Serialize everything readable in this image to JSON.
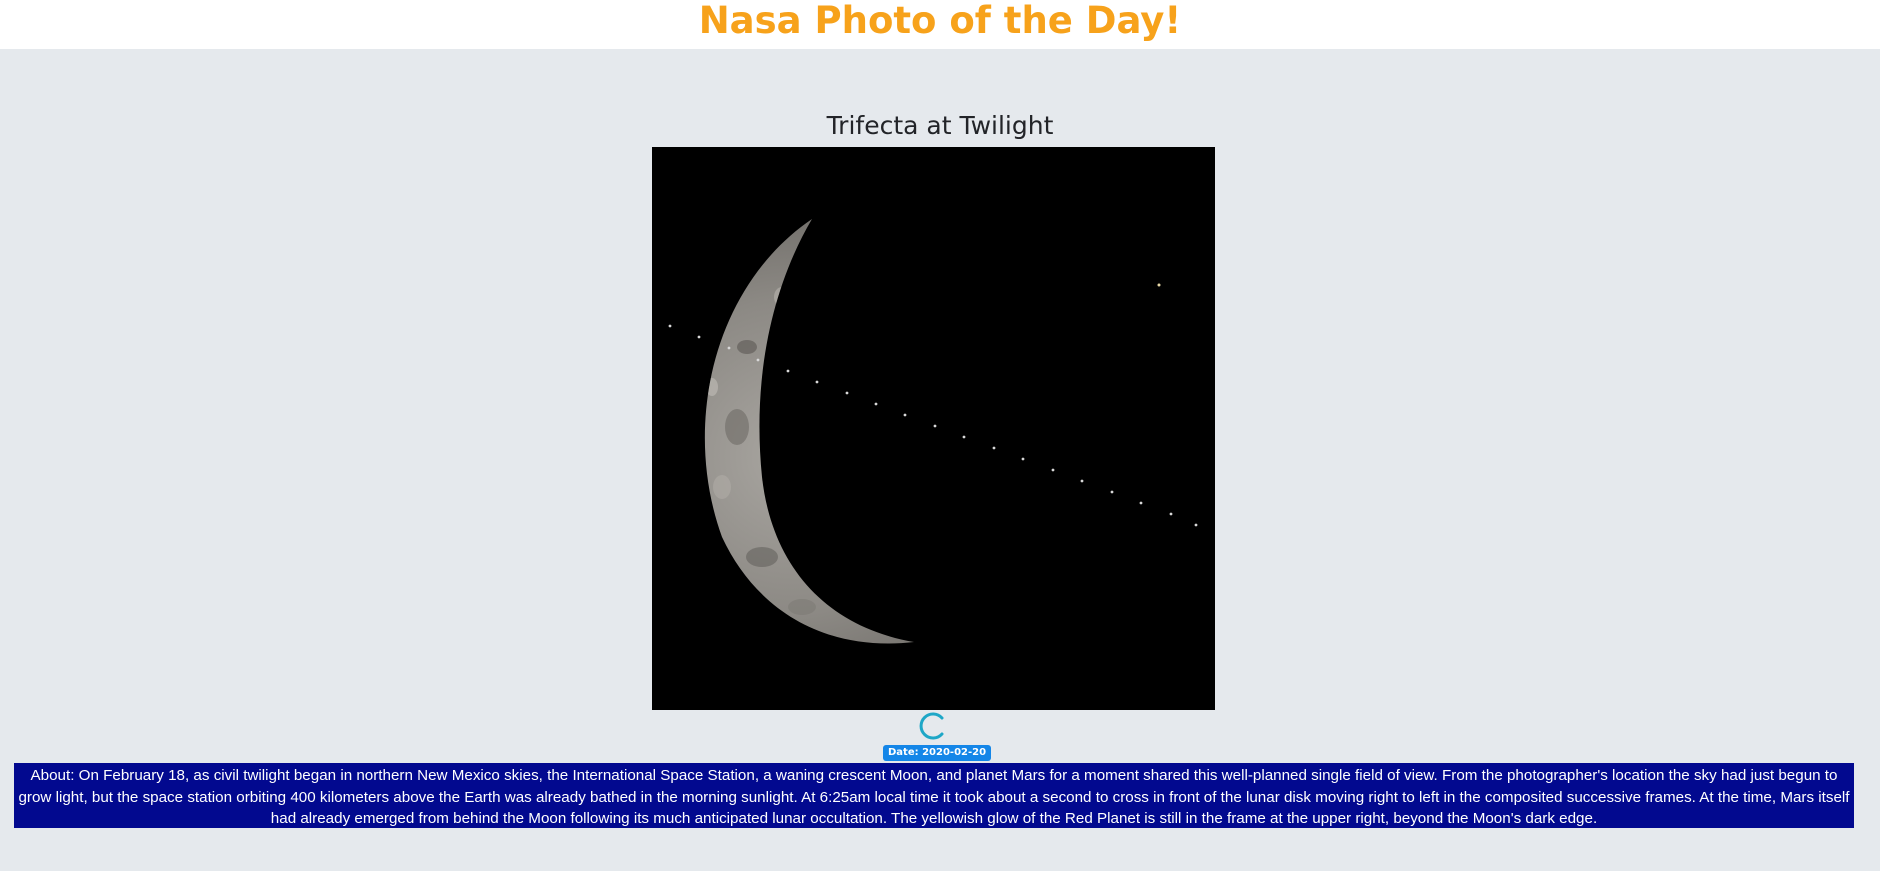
{
  "header": {
    "title": "Nasa Photo of the Day!"
  },
  "photo": {
    "title": "Trifecta at Twilight",
    "subject": "waning crescent Moon with International Space Station trail and Mars"
  },
  "loading": {
    "icon": "loading-spinner-icon",
    "color": "#1ea7c7"
  },
  "date_badge": {
    "label": "Date: 2020-02-20"
  },
  "about": {
    "text": "About: On February 18, as civil twilight began in northern New Mexico skies, the International Space Station, a waning crescent Moon, and planet Mars for a moment shared this well-planned single field of view. From the photographer's location the sky had just begun to grow light, but the space station orbiting 400 kilometers above the Earth was already bathed in the morning sunlight. At 6:25am local time it took about a second to cross in front of the lunar disk moving right to left in the composited successive frames. At the time, Mars itself had already emerged from behind the Moon following its much anticipated lunar occultation. The yellowish glow of the Red Planet is still in the frame at the upper right, beyond the Moon's dark edge."
  },
  "colors": {
    "title": "#f7a21b",
    "page_background": "#e5e9ed",
    "about_background": "#02098f",
    "badge_background": "#1486e8"
  }
}
